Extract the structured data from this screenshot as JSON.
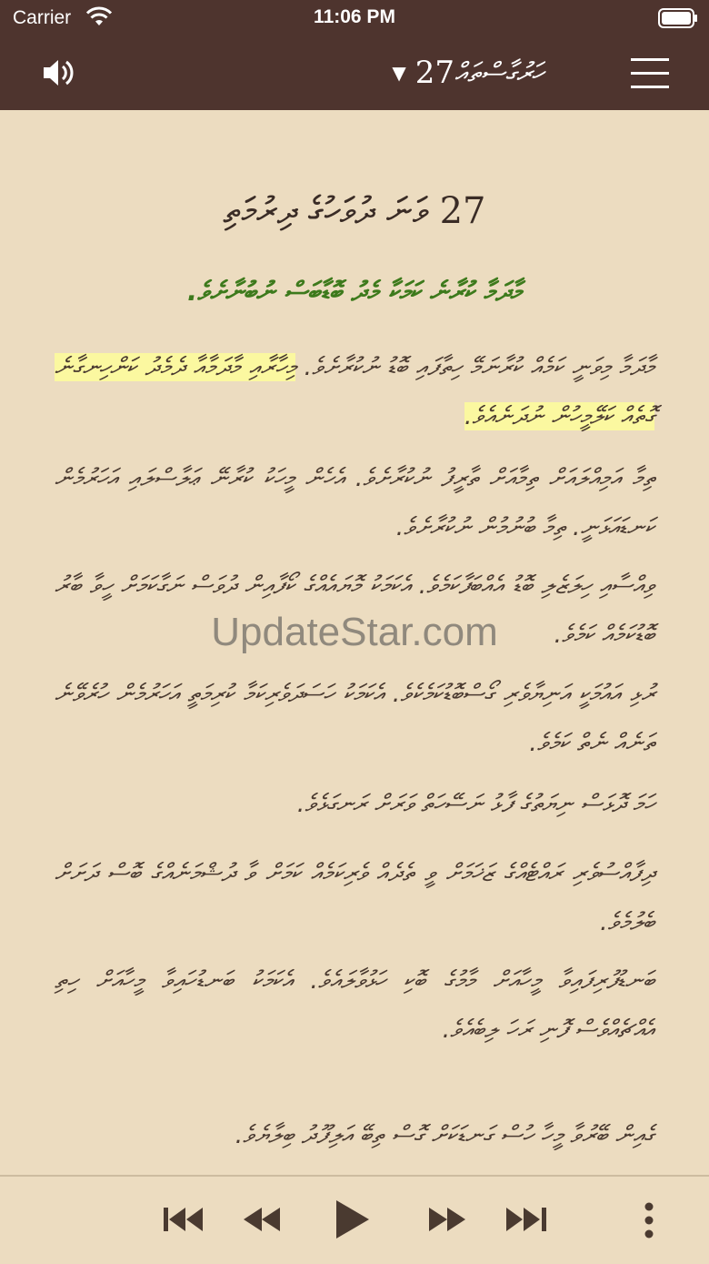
{
  "status_bar": {
    "carrier": "Carrier",
    "time": "11:06 PM"
  },
  "nav": {
    "chapter_number": "27",
    "dropdown_glyph": "▼",
    "book_title": "ހަރުގާސްތައް",
    "speaker_icon": "speaker-icon",
    "menu_icon": "hamburger-icon"
  },
  "content": {
    "chapter_heading": "27 ވަނަ ދުވަހުގެ ދިރުމަތި",
    "section_heading": "މާދަމާ ކުރާނެ ކަމަކާ މެދު ބޮޑާބަސް ނުބުނާށެވެ.",
    "verses": [
      {
        "text": "މާދަމާ މިވަނީ ކަމެއް ކުރާނަމޭ ހިތާފައި ބޮޑު ނުކުރާށެވެ.",
        "highlight": "މިހާރާއި މާދަމާއާ ދެމެދު ކަންހިނގާނެ ގޮތެއް ކަލޭމީހުން ނުދަނެއެވެ."
      },
      {
        "text": "ތިމާ އަމިއްލައަށް ތިމާއަށް ތާރީފު ނުކުރާށެވެ. އެހެން މީހަކު ކުރާނޭ ޢަލާސްލައި އަހަރުމެން ކަނޑައަޅަނީ. ތިމާ ބުނުމުން ނުކުރާށެވެ."
      },
      {
        "text": "ވިއްސާއި ހިލަޒެލި ބޮޑު އެއްބަފާކަމެވެ. އެކަމަކު މޮޔައެއްގެ ކޯފާއިން ދުވަސް ނަގާކަމަށް ހީވާ ބާރު ބޮޑުކަމެއް ކަމެވެ."
      },
      {
        "text": "ރުޅި އައުމަކީ އަނިޔާވެރި ގޯސްބޮޑުކަމެކެވެ. އެކަމަކު ހަސަދަވެރިކަމާ ކުރިމަތީ އަހަރުމެން ހުރެވޭނެ ތަނެއް ނެތް ކަމެވެ."
      },
      {
        "text": "ހަމަ ދޮޅަސް ނިޔަތުގެ ފާޅު ނަސޭހަތް ވަރަށް ރަނގަޅެވެ."
      },
      {
        "text": "ދިފާއްސުވެރި ރައްޓެއްގެ ޒަޚަމަށް ވީ ތެދެއް ވެރިކަމެއް ކަމަށް ވާ ދުޝްމަނެއްގެ ބޮސް ދަށަށް ބެލުމެވެ."
      },
      {
        "text": "ބަނޑުފުރިފައިވާ މީހާއަށް މާމުގެ ބޮކި ހަޅުވާލައެވެ. އެކަމަކު ބަނޑުހައިވާ މީހާއަށް ހިތި އެއްޗެއްވެސް ފޮނި ރަހަ ލިބެއެވެ."
      },
      {
        "text": "ގެއިން ބޭރުވާ މީހާ ހުސް ގަނޑަކަށް ގޮސް ތިބޭ އަލިފޫދު ބިލާޔެވެ."
      }
    ],
    "watermark": "UpdateStar.com"
  },
  "player": {
    "skip_back_icon": "skip-back-icon",
    "rewind_icon": "rewind-icon",
    "play_icon": "play-icon",
    "fast_forward_icon": "fast-forward-icon",
    "skip_forward_icon": "skip-forward-icon",
    "more_icon": "more-vertical-icon"
  },
  "colors": {
    "bar": "#4e342e",
    "page": "#ecdcc0",
    "section_heading": "#3d7a1c",
    "highlight": "#fbf8a0",
    "text": "#4a3a30"
  }
}
